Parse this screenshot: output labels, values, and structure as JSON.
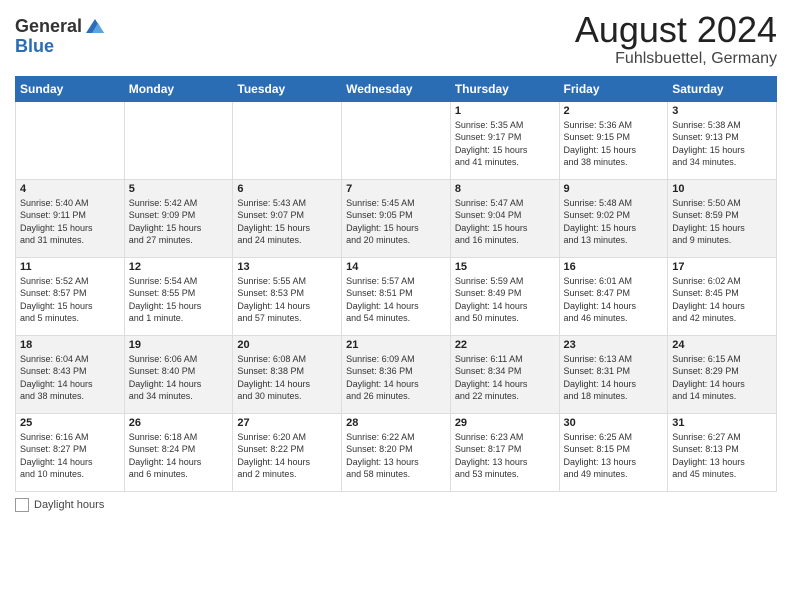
{
  "header": {
    "logo_general": "General",
    "logo_blue": "Blue",
    "month_title": "August 2024",
    "location": "Fuhlsbuettel, Germany"
  },
  "weekdays": [
    "Sunday",
    "Monday",
    "Tuesday",
    "Wednesday",
    "Thursday",
    "Friday",
    "Saturday"
  ],
  "weeks": [
    [
      {
        "day": "",
        "info": ""
      },
      {
        "day": "",
        "info": ""
      },
      {
        "day": "",
        "info": ""
      },
      {
        "day": "",
        "info": ""
      },
      {
        "day": "1",
        "info": "Sunrise: 5:35 AM\nSunset: 9:17 PM\nDaylight: 15 hours\nand 41 minutes."
      },
      {
        "day": "2",
        "info": "Sunrise: 5:36 AM\nSunset: 9:15 PM\nDaylight: 15 hours\nand 38 minutes."
      },
      {
        "day": "3",
        "info": "Sunrise: 5:38 AM\nSunset: 9:13 PM\nDaylight: 15 hours\nand 34 minutes."
      }
    ],
    [
      {
        "day": "4",
        "info": "Sunrise: 5:40 AM\nSunset: 9:11 PM\nDaylight: 15 hours\nand 31 minutes."
      },
      {
        "day": "5",
        "info": "Sunrise: 5:42 AM\nSunset: 9:09 PM\nDaylight: 15 hours\nand 27 minutes."
      },
      {
        "day": "6",
        "info": "Sunrise: 5:43 AM\nSunset: 9:07 PM\nDaylight: 15 hours\nand 24 minutes."
      },
      {
        "day": "7",
        "info": "Sunrise: 5:45 AM\nSunset: 9:05 PM\nDaylight: 15 hours\nand 20 minutes."
      },
      {
        "day": "8",
        "info": "Sunrise: 5:47 AM\nSunset: 9:04 PM\nDaylight: 15 hours\nand 16 minutes."
      },
      {
        "day": "9",
        "info": "Sunrise: 5:48 AM\nSunset: 9:02 PM\nDaylight: 15 hours\nand 13 minutes."
      },
      {
        "day": "10",
        "info": "Sunrise: 5:50 AM\nSunset: 8:59 PM\nDaylight: 15 hours\nand 9 minutes."
      }
    ],
    [
      {
        "day": "11",
        "info": "Sunrise: 5:52 AM\nSunset: 8:57 PM\nDaylight: 15 hours\nand 5 minutes."
      },
      {
        "day": "12",
        "info": "Sunrise: 5:54 AM\nSunset: 8:55 PM\nDaylight: 15 hours\nand 1 minute."
      },
      {
        "day": "13",
        "info": "Sunrise: 5:55 AM\nSunset: 8:53 PM\nDaylight: 14 hours\nand 57 minutes."
      },
      {
        "day": "14",
        "info": "Sunrise: 5:57 AM\nSunset: 8:51 PM\nDaylight: 14 hours\nand 54 minutes."
      },
      {
        "day": "15",
        "info": "Sunrise: 5:59 AM\nSunset: 8:49 PM\nDaylight: 14 hours\nand 50 minutes."
      },
      {
        "day": "16",
        "info": "Sunrise: 6:01 AM\nSunset: 8:47 PM\nDaylight: 14 hours\nand 46 minutes."
      },
      {
        "day": "17",
        "info": "Sunrise: 6:02 AM\nSunset: 8:45 PM\nDaylight: 14 hours\nand 42 minutes."
      }
    ],
    [
      {
        "day": "18",
        "info": "Sunrise: 6:04 AM\nSunset: 8:43 PM\nDaylight: 14 hours\nand 38 minutes."
      },
      {
        "day": "19",
        "info": "Sunrise: 6:06 AM\nSunset: 8:40 PM\nDaylight: 14 hours\nand 34 minutes."
      },
      {
        "day": "20",
        "info": "Sunrise: 6:08 AM\nSunset: 8:38 PM\nDaylight: 14 hours\nand 30 minutes."
      },
      {
        "day": "21",
        "info": "Sunrise: 6:09 AM\nSunset: 8:36 PM\nDaylight: 14 hours\nand 26 minutes."
      },
      {
        "day": "22",
        "info": "Sunrise: 6:11 AM\nSunset: 8:34 PM\nDaylight: 14 hours\nand 22 minutes."
      },
      {
        "day": "23",
        "info": "Sunrise: 6:13 AM\nSunset: 8:31 PM\nDaylight: 14 hours\nand 18 minutes."
      },
      {
        "day": "24",
        "info": "Sunrise: 6:15 AM\nSunset: 8:29 PM\nDaylight: 14 hours\nand 14 minutes."
      }
    ],
    [
      {
        "day": "25",
        "info": "Sunrise: 6:16 AM\nSunset: 8:27 PM\nDaylight: 14 hours\nand 10 minutes."
      },
      {
        "day": "26",
        "info": "Sunrise: 6:18 AM\nSunset: 8:24 PM\nDaylight: 14 hours\nand 6 minutes."
      },
      {
        "day": "27",
        "info": "Sunrise: 6:20 AM\nSunset: 8:22 PM\nDaylight: 14 hours\nand 2 minutes."
      },
      {
        "day": "28",
        "info": "Sunrise: 6:22 AM\nSunset: 8:20 PM\nDaylight: 13 hours\nand 58 minutes."
      },
      {
        "day": "29",
        "info": "Sunrise: 6:23 AM\nSunset: 8:17 PM\nDaylight: 13 hours\nand 53 minutes."
      },
      {
        "day": "30",
        "info": "Sunrise: 6:25 AM\nSunset: 8:15 PM\nDaylight: 13 hours\nand 49 minutes."
      },
      {
        "day": "31",
        "info": "Sunrise: 6:27 AM\nSunset: 8:13 PM\nDaylight: 13 hours\nand 45 minutes."
      }
    ]
  ],
  "footer": {
    "daylight_label": "Daylight hours"
  }
}
